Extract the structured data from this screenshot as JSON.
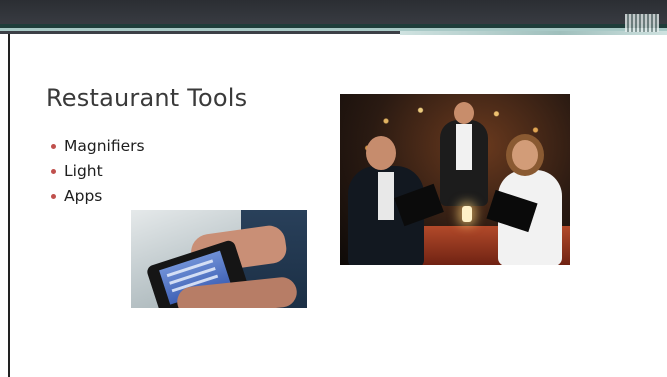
{
  "slide": {
    "title": "Restaurant Tools",
    "bullets": [
      {
        "label": "Magnifiers"
      },
      {
        "label": "Light"
      },
      {
        "label": "Apps"
      }
    ]
  },
  "images": [
    {
      "name": "smartphone-magnifier-photo"
    },
    {
      "name": "restaurant-dining-photo"
    }
  ],
  "colors": {
    "header_band": "#2b2e33",
    "accent_stripe": "#a8c9c6",
    "bullet": "#c0504d",
    "title_text": "#3a3a3a"
  }
}
